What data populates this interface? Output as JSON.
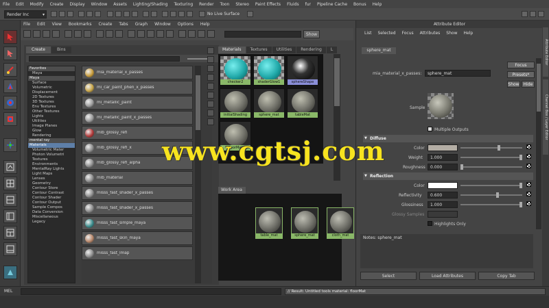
{
  "main_menu": [
    "File",
    "Edit",
    "Modify",
    "Create",
    "Display",
    "Window",
    "Assets",
    "Lighting/Shading",
    "Texturing",
    "Render",
    "Toon",
    "Stereo",
    "Paint Effects",
    "Fluids",
    "fur",
    "Pipeline Cache",
    "Bonus",
    "Help"
  ],
  "status_line": {
    "mode": "Render Inc",
    "no_live_surface": "No Live Surface"
  },
  "hypershade": {
    "menu": [
      "File",
      "Edit",
      "View",
      "Bookmarks",
      "Create",
      "Tabs",
      "Graph",
      "Window",
      "Options",
      "Help"
    ],
    "show_button": "Show",
    "create_tabs": [
      "Create",
      "Bins"
    ],
    "categories": [
      {
        "label": "Favorites",
        "kind": "head"
      },
      {
        "label": "Maya",
        "kind": "item"
      },
      {
        "label": "Maya",
        "kind": "head"
      },
      {
        "label": "Surface",
        "kind": "item"
      },
      {
        "label": "Volumetric",
        "kind": "item"
      },
      {
        "label": "Displacement",
        "kind": "item"
      },
      {
        "label": "2D Textures",
        "kind": "item"
      },
      {
        "label": "3D Textures",
        "kind": "item"
      },
      {
        "label": "Env Textures",
        "kind": "item"
      },
      {
        "label": "Other Textures",
        "kind": "item"
      },
      {
        "label": "Lights",
        "kind": "item"
      },
      {
        "label": "Utilities",
        "kind": "item"
      },
      {
        "label": "Image Planes",
        "kind": "item"
      },
      {
        "label": "Glow",
        "kind": "item"
      },
      {
        "label": "Rendering",
        "kind": "item"
      },
      {
        "label": "mental ray",
        "kind": "head"
      },
      {
        "label": "Materials",
        "kind": "sel"
      },
      {
        "label": "Volumetric Mater",
        "kind": "item"
      },
      {
        "label": "Photon Volumetri",
        "kind": "item"
      },
      {
        "label": "Textures",
        "kind": "item"
      },
      {
        "label": "Environments",
        "kind": "item"
      },
      {
        "label": "MentalRay Lights",
        "kind": "item"
      },
      {
        "label": "Light Maps",
        "kind": "item"
      },
      {
        "label": "Lenses",
        "kind": "item"
      },
      {
        "label": "Geometry",
        "kind": "item"
      },
      {
        "label": "Contour Store",
        "kind": "item"
      },
      {
        "label": "Contour Contrast",
        "kind": "item"
      },
      {
        "label": "Contour Shader",
        "kind": "item"
      },
      {
        "label": "Contour Output",
        "kind": "item"
      },
      {
        "label": "Sample Compos",
        "kind": "item"
      },
      {
        "label": "Data Conversion",
        "kind": "item"
      },
      {
        "label": "Miscellaneous",
        "kind": "item"
      },
      {
        "label": "Legacy",
        "kind": "item"
      }
    ],
    "nodes": [
      {
        "label": "mia_material_x_passes",
        "color": "#c79b3a"
      },
      {
        "label": "mi_car_paint_phen_x_passes",
        "color": "#c7a447"
      },
      {
        "label": "mi_metallic_paint",
        "color": "#9a9a9a"
      },
      {
        "label": "mi_metallic_paint_x_passes",
        "color": "#9a9a9a"
      },
      {
        "label": "mib_glossy_refl",
        "color": "#b33a3a"
      },
      {
        "label": "mib_glossy_refl_x",
        "color": "#8c8c8c"
      },
      {
        "label": "mib_glossy_refl_alpha",
        "color": "#8c8c8c"
      },
      {
        "label": "mib_material",
        "color": "#8c8c8c"
      },
      {
        "label": "misss_fast_shader_x_passes",
        "color": "#8c8c8c"
      },
      {
        "label": "misss_fast_shader_x_passes",
        "color": "#8c8c8c"
      },
      {
        "label": "misss_fast_simple_maya",
        "color": "#3a8c8c"
      },
      {
        "label": "misss_fast_skin_maya",
        "color": "#b8876a"
      },
      {
        "label": "misss_fast_lmap",
        "color": "#8c8c8c"
      }
    ],
    "material_tabs": [
      "Materials",
      "Textures",
      "Utilities",
      "Rendering",
      "L"
    ],
    "materials": [
      {
        "label": "checker2",
        "sel": false,
        "checker": true
      },
      {
        "label": "shaderGlow1",
        "sel": false,
        "checker": true
      },
      {
        "label": "sphereShape",
        "sel": true,
        "checker": false
      },
      {
        "label": "initialShading",
        "sel": false,
        "checker": false
      },
      {
        "label": "sphere_mat",
        "sel": false,
        "checker": false
      },
      {
        "label": "tableMat",
        "sel": false,
        "checker": false
      },
      {
        "label": "floorMat",
        "sel": false,
        "checker": false
      }
    ],
    "work_area_tab": "Work Area",
    "work_nodes": [
      "table_mat",
      "sphere_mat",
      "cloth_mat"
    ]
  },
  "attribute_editor": {
    "title": "Attribute Editor",
    "menu": [
      "List",
      "Selected",
      "Focus",
      "Attributes",
      "Show",
      "Help"
    ],
    "tab": "sphere_mat",
    "type_label": "mia_material_x_passes:",
    "name_value": "sphere_mat",
    "buttons": {
      "focus": "Focus",
      "presets": "Presets*",
      "show": "Show",
      "hide": "Hide"
    },
    "sample_label": "Sample",
    "multiple_outputs_label": "Multiple Outputs",
    "sections": {
      "diffuse": "Diffuse",
      "reflection": "Reflection"
    },
    "diffuse": {
      "color_label": "Color",
      "weight_label": "Weight",
      "weight_value": "1.000",
      "roughness_label": "Roughness",
      "roughness_value": "0.000",
      "weight_fraction": 1.0,
      "roughness_fraction": 0.0
    },
    "reflection": {
      "color_label": "Color",
      "reflectivity_label": "Reflectivity",
      "reflectivity_value": "0.600",
      "reflectivity_fraction": 0.6,
      "glossiness_label": "Glossiness",
      "glossiness_value": "1.000",
      "glossiness_fraction": 1.0,
      "glossy_samples_label": "Glossy Samples",
      "highlights_only_label": "Highlights Only"
    },
    "notes_label": "Notes: sphere_mat",
    "bottom_buttons": [
      "Select",
      "Load Attributes",
      "Copy Tab"
    ]
  },
  "side_tabs": [
    "Attribute Editor",
    "Channel Box / Layer Editor"
  ],
  "command_line": {
    "label": "MEL",
    "result": "// Result: Untitled tools material: floorMat"
  },
  "watermark": "www.cgtsj.com",
  "colors": {
    "diffuse_color": "#b3ada4",
    "reflection_color": "#ffffff",
    "material_label_green": "#8ab868",
    "selection_purple": "#8a8ed8",
    "watermark_yellow": "#f7e31f"
  }
}
